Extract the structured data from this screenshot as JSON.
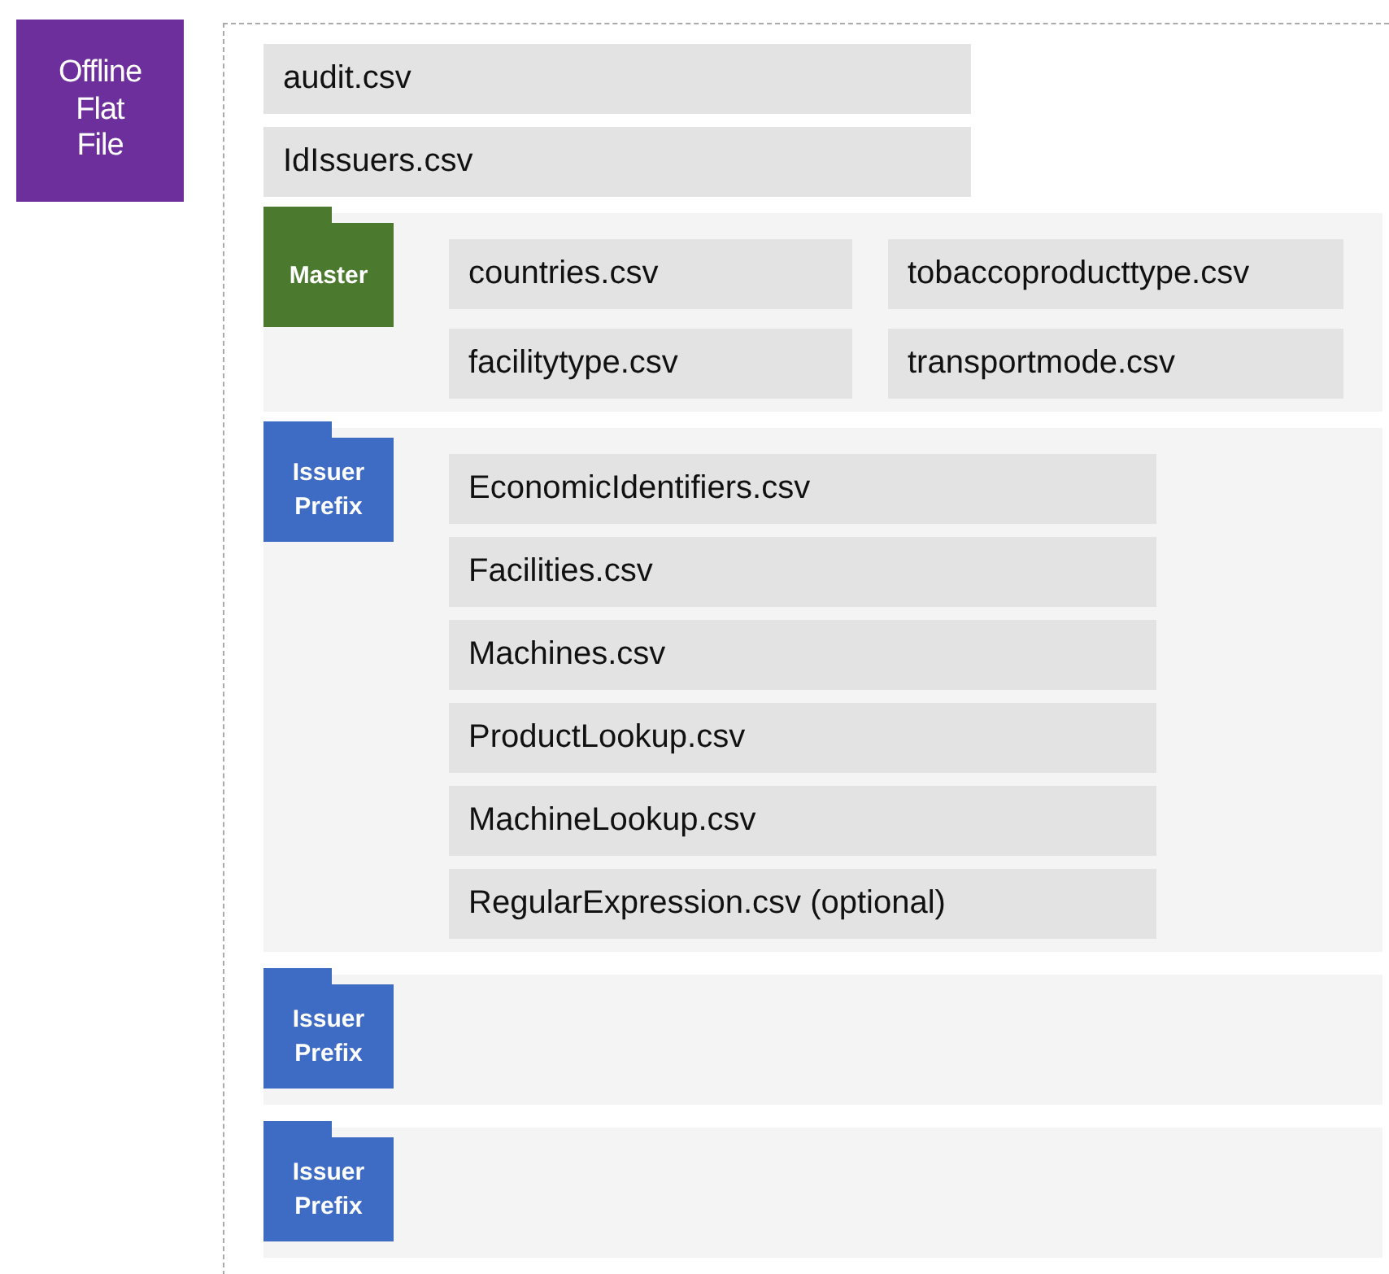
{
  "root_label": "Offline Flat File",
  "files": [
    "audit.csv",
    "IdIssuers.csv"
  ],
  "groups": [
    {
      "label": "Master",
      "kind": "grid",
      "color": "#4b7a2f",
      "files": [
        "countries.csv",
        "tobaccoproducttype.csv",
        "facilitytype.csv",
        "transportmode.csv"
      ]
    },
    {
      "label": "Issuer Prefix",
      "kind": "list",
      "color": "#3e6bc3",
      "files": [
        "EconomicIdentifiers.csv",
        "Facilities.csv",
        "Machines.csv",
        "ProductLookup.csv",
        "MachineLookup.csv",
        "RegularExpression.csv (optional)"
      ]
    },
    {
      "label": "Issuer Prefix",
      "color": "#3e6bc3"
    },
    {
      "label": "Issuer Prefix",
      "color": "#3e6bc3"
    }
  ]
}
